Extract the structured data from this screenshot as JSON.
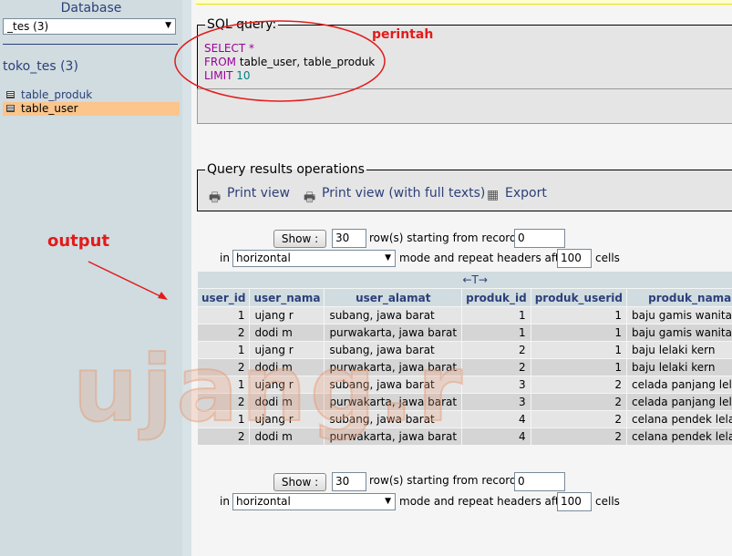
{
  "left": {
    "database_label": "Database",
    "db_select_value": "_tes (3)",
    "db_name": "toko_tes (3)",
    "tables": [
      {
        "label": "table_produk",
        "selected": false
      },
      {
        "label": "table_user",
        "selected": true
      }
    ]
  },
  "sql": {
    "legend": "SQL query:",
    "line1_kw": "SELECT",
    "line1_rest": " *",
    "line2_kw": "FROM",
    "line2_rest": " table_user, table_produk",
    "line3_kw": "LIMIT",
    "line3_num": " 10"
  },
  "operations": {
    "legend": "Query results operations",
    "print_view": "Print view",
    "print_view_full": "Print view (with full texts)",
    "export": "Export"
  },
  "pager": {
    "show_label": "Show :",
    "rows_value": "30",
    "rows_text": "row(s) starting from record #",
    "start_value": "0",
    "in_text": "in",
    "mode_value": "horizontal",
    "mode_text": "mode and repeat headers after",
    "repeat_value": "100",
    "cells_text": "cells"
  },
  "table": {
    "arrows": "←T→",
    "headers": [
      "user_id",
      "user_nama",
      "user_alamat",
      "produk_id",
      "produk_userid",
      "produk_nama"
    ],
    "rows": [
      [
        "1",
        "ujang r",
        "subang, jawa barat",
        "1",
        "1",
        "baju gamis wanita"
      ],
      [
        "2",
        "dodi m",
        "purwakarta, jawa barat",
        "1",
        "1",
        "baju gamis wanita"
      ],
      [
        "1",
        "ujang r",
        "subang, jawa barat",
        "2",
        "1",
        "baju lelaki kern"
      ],
      [
        "2",
        "dodi m",
        "purwakarta, jawa barat",
        "2",
        "1",
        "baju lelaki kern"
      ],
      [
        "1",
        "ujang r",
        "subang, jawa barat",
        "3",
        "2",
        "celada panjang lelaki"
      ],
      [
        "2",
        "dodi m",
        "purwakarta, jawa barat",
        "3",
        "2",
        "celada panjang lelaki"
      ],
      [
        "1",
        "ujang r",
        "subang, jawa barat",
        "4",
        "2",
        "celana pendek lelaki"
      ],
      [
        "2",
        "dodi m",
        "purwakarta, jawa barat",
        "4",
        "2",
        "celana pendek lelaki"
      ]
    ]
  },
  "annotations": {
    "perintah": "perintah",
    "output": "output",
    "watermark": "ujang.r",
    "color": "#e31b1b"
  }
}
